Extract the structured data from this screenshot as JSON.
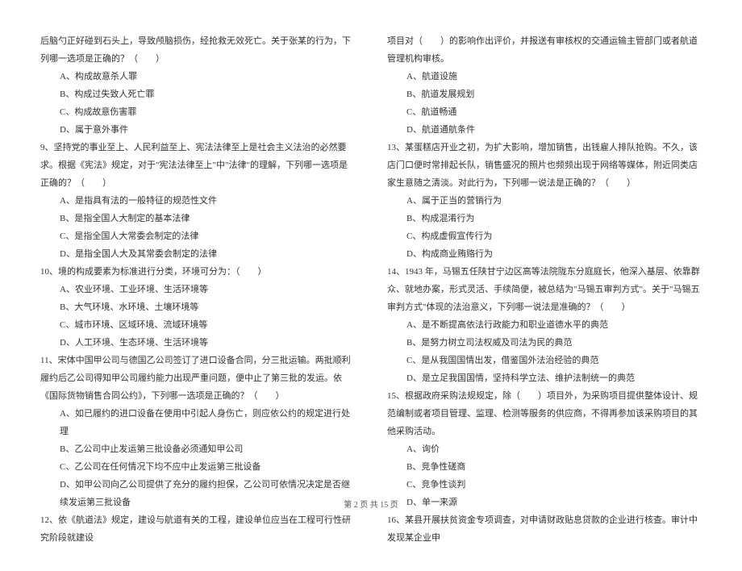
{
  "left": {
    "q8_tail": "后脑勺正好碰到石头上，导致颅脑损伤，经抢救无效死亡。关于张某的行为，下列哪一选项是正确的？（　　）",
    "q8_opts": [
      "A、构成故意杀人罪",
      "B、构成过失致人死亡罪",
      "C、构成故意伤害罪",
      "D、属于意外事件"
    ],
    "q9": "9、坚持党的事业至上、人民利益至上、宪法法律至上是社会主义法治的必然要求。根据《宪法》规定，对于\"宪法法律至上\"中\"法律\"的理解，下列哪一选项是正确的？（　　）",
    "q9_opts": [
      "A、是指具有法的一般特征的规范性文件",
      "B、是指全国人大制定的基本法律",
      "C、是指全国人大常委会制定的法律",
      "D、是指全国人大及其常委会制定的法律"
    ],
    "q10": "10、境的构成要素为标准进行分类，环境可分为：（　　）",
    "q10_opts": [
      "A、农业环境、工业环境、生活环境等",
      "B、大气环境、水环境、土壤环境等",
      "C、城市环境、区域环境、流域环境等",
      "D、人工环境、生态环境、生活环境等"
    ],
    "q11": "11、宋体中国甲公司与德国乙公司签订了进口设备合同，分三批运输。两批顺利履约后乙公司得知甲公司履约能力出现严重问题，便中止了第三批的发运。依《国际货物销售合同公约》，下列哪一选项是正确的？（　　）",
    "q11_opts": [
      "A、如已履约的进口设备在使用中引起人身伤亡，则应依公约的规定进行处理",
      "B、乙公司中止发运第三批设备必须通知甲公司",
      "C、乙公司在任何情况下均不应中止发运第三批设备",
      "D、如甲公司向乙公司提供了充分的履约担保，乙公司可依情况决定是否继续发运第三批设备"
    ],
    "q12": "12、依《航道法》规定，建设与航道有关的工程，建设单位应当在工程可行性研究阶段就建设"
  },
  "right": {
    "q12_tail": "项目对（　　）的影响作出评价，并报送有审核权的交通运输主管部门或者航道管理机构审核。",
    "q12_opts": [
      "A、航道设施",
      "B、航道发展规划",
      "C、航道畅通",
      "D、航道通航条件"
    ],
    "q13": "13、某蛋糕店开业之初，为扩大影响，增加销售，出钱雇人排队抢购。不久，该店门口便时常排起长队，销售盛况的照片也频频出现于网络等媒体，附近同类店家生意随之清淡。对此行为，下列哪一说法是正确的？（　　）",
    "q13_opts": [
      "A、属于正当的营销行为",
      "B、构成混淆行为",
      "C、构成虚假宣传行为",
      "D、构成商业贿赂行为"
    ],
    "q14": "14、1943 年，马锡五任陕甘宁边区高等法院陇东分庭庭长，他深入基层、依靠群众、就地办案，形式灵活、手续简便，被总结为\"马锡五审判方式\"。关于\"马锡五审判方式\"体现的法治意义，下列哪一说法是准确的？（　　）",
    "q14_opts": [
      "A、是不断提高依法行政能力和职业道德水平的典范",
      "B、是努力树立司法权威及司法为民的典范",
      "C、是从我国国情出发，借鉴国外法治经验的典范",
      "D、是立足我国国情，坚持科学立法、维护法制统一的典范"
    ],
    "q15": "15、根据政府采购法规规定，除（　　）项目外，为采购项目提供整体设计、规范编制或者项目管理、监理、检测等服务的供应商，不得再参加该采购项目的其他采购活动。",
    "q15_opts": [
      "A、询价",
      "B、竞争性磋商",
      "C、竞争性谈判",
      "D、单一来源"
    ],
    "q16": "16、某县开展扶贫资金专项调查，对申请财政贴息贷款的企业进行核查。审计中发现某企业申"
  },
  "footer": "第 2 页 共 15 页"
}
